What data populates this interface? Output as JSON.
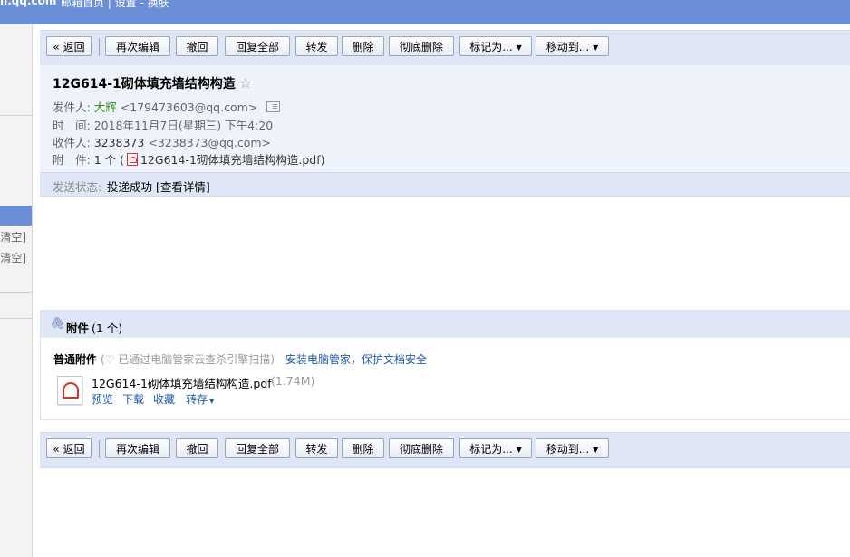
{
  "topbar": {
    "domain": "il.qq.com",
    "links": "邮箱首页 | 设置 - 换肤"
  },
  "sidebar": {
    "clear1": "清空]",
    "clear2": "清空]"
  },
  "toolbar": {
    "back": "« 返回",
    "reedit": "再次编辑",
    "recall": "撤回",
    "reply_all": "回复全部",
    "forward": "转发",
    "delete": "删除",
    "delete_forever": "彻底删除",
    "mark_as": "标记为...",
    "move_to": "移动到..."
  },
  "mail": {
    "subject": "12G614-1砌体填充墙结构构造",
    "star": "☆",
    "from_label": "发件人:",
    "from_name": "大辉",
    "from_addr": "<179473603@qq.com>",
    "time_label": "时　间:",
    "time_value": "2018年11月7日(星期三) 下午4:20",
    "to_label": "收件人:",
    "to_name": "3238373",
    "to_addr": "<3238373@qq.com>",
    "attach_label": "附　件:",
    "attach_count": "1 个 (",
    "attach_file": "12G614-1砌体填充墙结构构造.pdf)",
    "status_label": "发送状态:",
    "status_value": "投递成功 [查看详情]"
  },
  "attachments": {
    "title": "附件",
    "count": "(1 个)",
    "kind": "普通附件",
    "scan_note": "(♡ 已通过电脑管家云查杀引擎扫描)",
    "install_link": "安装电脑管家，保护文档安全",
    "file_name": "12G614-1砌体填充墙结构构造.pdf",
    "file_size": "(1.74M)",
    "op_preview": "预览",
    "op_download": "下载",
    "op_collect": "收藏",
    "op_save": "转存"
  }
}
